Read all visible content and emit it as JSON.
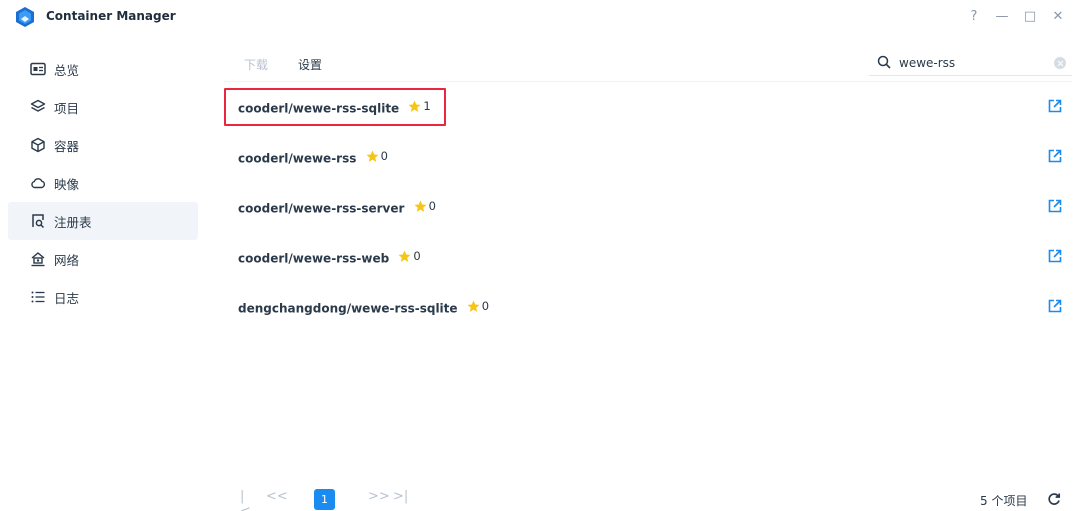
{
  "app": {
    "title": "Container Manager",
    "logo_icon": "container-manager-logo",
    "window_controls": {
      "help": "?",
      "minimize": "—",
      "maximize": "□",
      "close": "✕"
    }
  },
  "sidebar": {
    "items": [
      {
        "label": "总览",
        "icon": "overview-icon"
      },
      {
        "label": "项目",
        "icon": "project-icon"
      },
      {
        "label": "容器",
        "icon": "container-icon"
      },
      {
        "label": "映像",
        "icon": "image-cloud-icon"
      },
      {
        "label": "注册表",
        "icon": "registry-icon",
        "active": true
      },
      {
        "label": "网络",
        "icon": "network-icon"
      },
      {
        "label": "日志",
        "icon": "log-icon"
      }
    ]
  },
  "toolbar": {
    "download_label": "下载",
    "settings_label": "设置",
    "search": {
      "value": "wewe-rss",
      "placeholder": ""
    }
  },
  "results": [
    {
      "name": "cooderl/wewe-rss-sqlite",
      "stars": "1"
    },
    {
      "name": "cooderl/wewe-rss",
      "stars": "0"
    },
    {
      "name": "cooderl/wewe-rss-server",
      "stars": "0"
    },
    {
      "name": "cooderl/wewe-rss-web",
      "stars": "0"
    },
    {
      "name": "dengchangdong/wewe-rss-sqlite",
      "stars": "0"
    }
  ],
  "footer": {
    "pagination": {
      "first": "|<",
      "prev": "<<",
      "current": "1",
      "next": ">>",
      "last": ">|"
    },
    "item_count": "5 个项目"
  },
  "colors": {
    "accent": "#1a8cf0",
    "star": "#f5c518",
    "highlight": "#e8273e",
    "text": "#2b3a4a"
  }
}
